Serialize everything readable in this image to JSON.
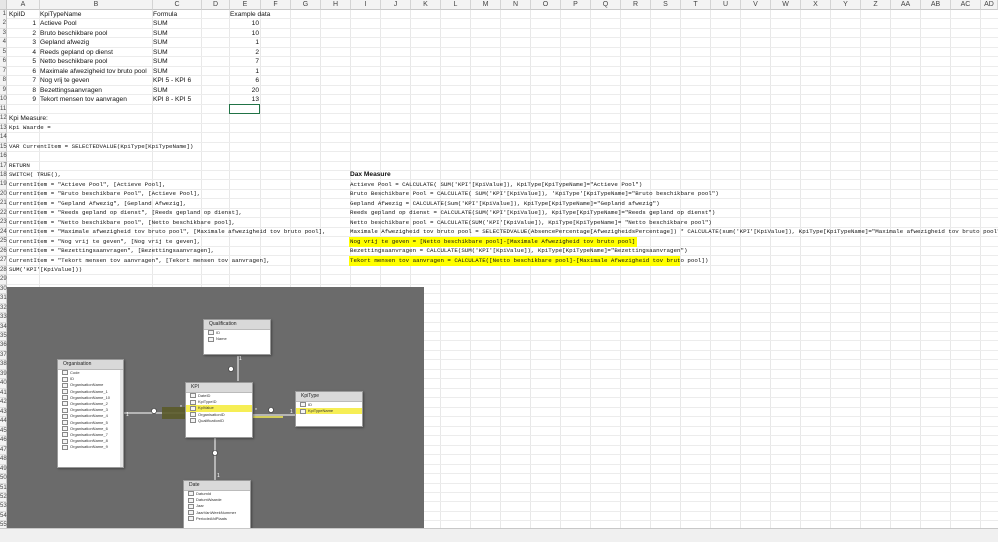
{
  "columns": [
    "A",
    "B",
    "C",
    "D",
    "E",
    "F",
    "G",
    "H",
    "I",
    "J",
    "K",
    "L",
    "M",
    "N",
    "O",
    "P",
    "Q",
    "R",
    "S",
    "T",
    "U",
    "V",
    "W",
    "X",
    "Y",
    "Z",
    "AA",
    "AB",
    "AC",
    "AD"
  ],
  "rows": [
    "1",
    "2",
    "3",
    "4",
    "5",
    "6",
    "7",
    "8",
    "9",
    "10",
    "11",
    "12",
    "13",
    "14",
    "15",
    "16",
    "17",
    "18",
    "19",
    "20",
    "21",
    "22",
    "23",
    "24",
    "25",
    "26",
    "27",
    "28",
    "29",
    "30",
    "31",
    "32",
    "33",
    "34",
    "35",
    "36",
    "37",
    "38",
    "39",
    "40",
    "41",
    "42",
    "43",
    "44",
    "45",
    "46",
    "47",
    "48",
    "49",
    "50",
    "51",
    "52",
    "53",
    "54",
    "55"
  ],
  "header_row": {
    "a": "KpiID",
    "b": "KpiTypeName",
    "c": "Formula",
    "e": "Example data"
  },
  "kpi_rows": [
    {
      "id": "1",
      "name": "Actieve Pool",
      "formula": "SUM",
      "example": "10"
    },
    {
      "id": "2",
      "name": "Bruto beschikbare pool",
      "formula": "SUM",
      "example": "10"
    },
    {
      "id": "3",
      "name": "Gepland afwezig",
      "formula": "SUM",
      "example": "1"
    },
    {
      "id": "4",
      "name": "Reeds gepland op dienst",
      "formula": "SUM",
      "example": "2"
    },
    {
      "id": "5",
      "name": "Netto beschikbare pool",
      "formula": "SUM",
      "example": "7"
    },
    {
      "id": "6",
      "name": "Maximale afwezigheid tov bruto pool",
      "formula": "SUM",
      "example": "1"
    },
    {
      "id": "7",
      "name": "Nog vrij te geven",
      "formula": "KPI 5 - KPI 6",
      "example": "6"
    },
    {
      "id": "8",
      "name": "Bezettingsaanvragen",
      "formula": "SUM",
      "example": "20"
    },
    {
      "id": "9",
      "name": "Tekort mensen tov aanvragen",
      "formula": "KPI 8 - KPI 5",
      "example": "13"
    }
  ],
  "measure": {
    "r12": "Kpi Measure:",
    "r13": "Kpi Waarde =",
    "r15": "VAR CurrentItem = SELECTEDVALUE(KpiType[KpiTypeName])",
    "r17": "RETURN",
    "r18": "SWITCH( TRUE(),",
    "r19": "CurrentItem = \"Actieve Pool\", [Actieve Pool],",
    "r20": "CurrentItem = \"Bruto beschikbare Pool\", [Actieve Pool],",
    "r21": "CurrentItem = \"Gepland Afwezig\", [Gepland Afwezig],",
    "r22": "CurrentItem = \"Reeds gepland op dienst\", [Reeds gepland op dienst],",
    "r23": "CurrentItem = \"Netto beschikbare pool\", [Netto beschikbare pool],",
    "r24": "CurrentItem = \"Maximale afwezigheid tov bruto pool\", [Maximale afwezigheid tov bruto pool],",
    "r25": "CurrentItem = \"Nog vrij te geven\", [Nog vrij te geven],",
    "r26": "CurrentItem = \"Bezettingsaanvragen\", [Bezettingsaanvragen],",
    "r27": "CurrentItem = \"Tekort mensen tov aanvragen\", [Tekort mensen tov aanvragen],",
    "r28": "SUM('KPI'[KpiValue]))"
  },
  "dax": {
    "title": "Dax Measure",
    "r19": "Actieve Pool = CALCULATE( SUM('KPI'[KpiValue]), KpiType[KpiTypeName]=\"Actieve Pool\")",
    "r20": "Bruto Beschikbare Pool = CALCULATE( SUM('KPI'[KpiValue]), 'KpiType'[KpiTypeName]=\"Bruto beschikbare pool\")",
    "r21": "Gepland Afwezig = CALCULATE(Sum('KPI'[KpiValue]), KpiType[KpiTypeName]=\"Gepland afwezig\")",
    "r22": "Reeds gepland op dienst = CALCULATE(SUM('KPI'[KpiValue]), KpiType[KpiTypeName]=\"Reeds gepland op dienst\")",
    "r23": "Netto beschikbare pool = CALCULATE(SUM('KPI'[KpiValue]), KpiType[KpiTypeName]= \"Netto beschikbare pool\")",
    "r24": "Maximale Afwezigheid tov bruto pool = SELECTEDVALUE(AbsencePercentage[AfwezigheidsPercentage]) * CALCULATE(sum('KPI'[KpiValue]), KpiType[KpiTypeName]=\"Maximale afwezigheid tov bruto pool\")",
    "r25": "Nog vrij te geven = [Netto beschikbare pool]-[Maximale Afwezigheid tov bruto pool]",
    "r26": "Bezettingsaanvragen = CALCULATE(SUM('KPI'[KpiValue]), KpiType[KpiTypeName]=\"Bezettingsaanvragen\")",
    "r27": "Tekort mensen tov aanvragen = CALCULATE([Netto beschikbare pool]-[Maximale Afwezigheid tov bruto pool])"
  },
  "diagram": {
    "qualification": {
      "title": "Qualification",
      "fields": [
        "ID",
        "Name"
      ]
    },
    "organisation": {
      "title": "Organisation",
      "fields": [
        "Code",
        "ID",
        "OrganisationName",
        "OrganisationName_1",
        "OrganisationName_10",
        "OrganisationName_2",
        "OrganisationName_3",
        "OrganisationName_4",
        "OrganisationName_5",
        "OrganisationName_6",
        "OrganisationName_7",
        "OrganisationName_8",
        "OrganisationName_9"
      ]
    },
    "kpi": {
      "title": "KPI",
      "fields": [
        "DateID",
        "KpiTypeID",
        "KpiValue",
        "OrganisationID",
        "QualificationID"
      ]
    },
    "kpitype": {
      "title": "KpiType",
      "fields": [
        "ID",
        "KpiTypeName"
      ]
    },
    "date": {
      "title": "Date",
      "fields": [
        "DatumId",
        "DatumWaarde",
        "Jaar",
        "JaarVanWeekNummer",
        "PeriodeAfdPlaats"
      ]
    },
    "rel_one": "1",
    "rel_many": "*"
  },
  "colors": {
    "highlight": "#ffff00",
    "diagram_bg": "#6b6b6b",
    "selection": "#217346"
  }
}
